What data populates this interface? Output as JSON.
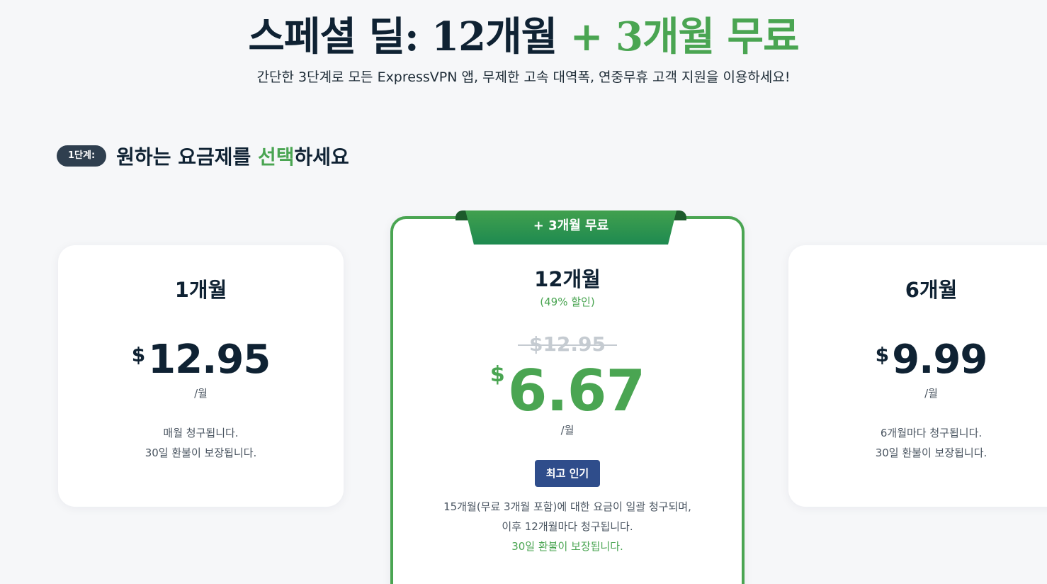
{
  "hero": {
    "title_main": "스페셜 딜: 12개월 ",
    "title_accent": "+ 3개월 무료",
    "subtitle": "간단한 3단계로 모든 ExpressVPN 앱, 무제한 고속 대역폭, 연중무휴 고객 지원을 이용하세요!"
  },
  "step": {
    "badge": "1단계:",
    "title_pre": "원하는 요금제를 ",
    "title_accent": "선택",
    "title_post": "하세요"
  },
  "plans": [
    {
      "name": "1개월",
      "currency": "$",
      "price": "12.95",
      "per": "/월",
      "note_line1": "매월 청구됩니다.",
      "note_line2": "30일 환불이 보장됩니다."
    },
    {
      "ribbon": "+ 3개월 무료",
      "name": "12개월",
      "discount": "(49% 할인)",
      "old_price": "$12.95",
      "currency": "$",
      "price": "6.67",
      "per": "/월",
      "badge": "최고 인기",
      "note_line1": "15개월(무료 3개월 포함)에 대한 요금이 일괄 청구되며,",
      "note_line2": "이후 12개월마다 청구됩니다.",
      "note_line3": "30일 환불이 보장됩니다."
    },
    {
      "name": "6개월",
      "currency": "$",
      "price": "9.99",
      "per": "/월",
      "note_line1": "6개월마다 청구됩니다.",
      "note_line2": "30일 환불이 보장됩니다."
    }
  ],
  "colors": {
    "accent": "#4aa552",
    "dark": "#0f2233",
    "badge_blue": "#2f4d8b"
  }
}
